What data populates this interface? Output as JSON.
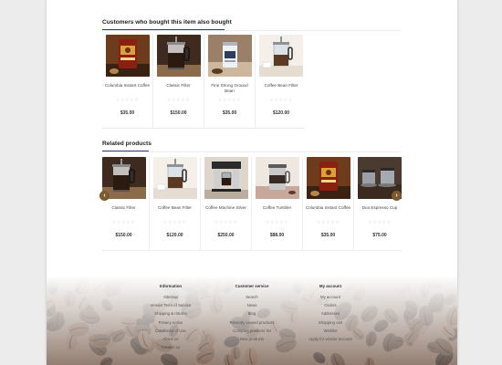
{
  "also_bought": {
    "title": "Customers who bought this item also bought",
    "products": [
      {
        "name": "Columbia Instant Coffee",
        "price": "$35.00",
        "stars": "☆☆☆☆☆",
        "image": "coffee-bag"
      },
      {
        "name": "Classic Filter",
        "price": "$150.00",
        "stars": "☆☆☆☆☆",
        "image": "french-press-dark"
      },
      {
        "name": "Fine Strong Ground Bean",
        "price": "$35.00",
        "stars": "☆☆☆☆☆",
        "image": "coffee-tin"
      },
      {
        "name": "Coffee Bean Filter",
        "price": "$120.00",
        "stars": "☆☆☆☆☆",
        "image": "french-press-light"
      }
    ]
  },
  "related": {
    "title": "Related products",
    "prev_icon": "chevron-left-icon",
    "next_icon": "chevron-right-icon",
    "prev_glyph": "‹",
    "next_glyph": "›",
    "products": [
      {
        "name": "Classic Filter",
        "price": "$150.00",
        "stars": "☆☆☆☆☆",
        "image": "french-press-dark"
      },
      {
        "name": "Coffee Bean Filter",
        "price": "$120.00",
        "stars": "☆☆☆☆☆",
        "image": "french-press-light"
      },
      {
        "name": "Coffee Machine Silver",
        "price": "$250.00",
        "stars": "☆☆☆☆☆",
        "image": "coffee-machine"
      },
      {
        "name": "Coffee Tumbler",
        "price": "$88.00",
        "stars": "☆☆☆☆☆",
        "image": "tumbler"
      },
      {
        "name": "Columbia Instant Coffee",
        "price": "$35.00",
        "stars": "☆☆☆☆☆",
        "image": "coffee-bag"
      },
      {
        "name": "Duo Espresso Cup",
        "price": "$75.00",
        "stars": "☆☆☆☆☆",
        "image": "espresso-cups"
      }
    ]
  },
  "footer": {
    "columns": [
      {
        "title": "Information",
        "links": [
          "Sitemap",
          "Vendor Term of Service",
          "Shipping & returns",
          "Privacy notice",
          "Conditions of Use",
          "About us",
          "Contact us"
        ]
      },
      {
        "title": "Customer service",
        "links": [
          "Search",
          "News",
          "Blog",
          "Recently viewed products",
          "Compare products list",
          "New products"
        ]
      },
      {
        "title": "My account",
        "links": [
          "My account",
          "Orders",
          "Addresses",
          "Shopping cart",
          "Wishlist",
          "Apply for vendor account"
        ]
      }
    ]
  },
  "colors": {
    "accent": "#2b3e7a",
    "arrow": "#7b5a2e",
    "page_bg": "#ffffff",
    "outer_bg": "#ececec"
  }
}
